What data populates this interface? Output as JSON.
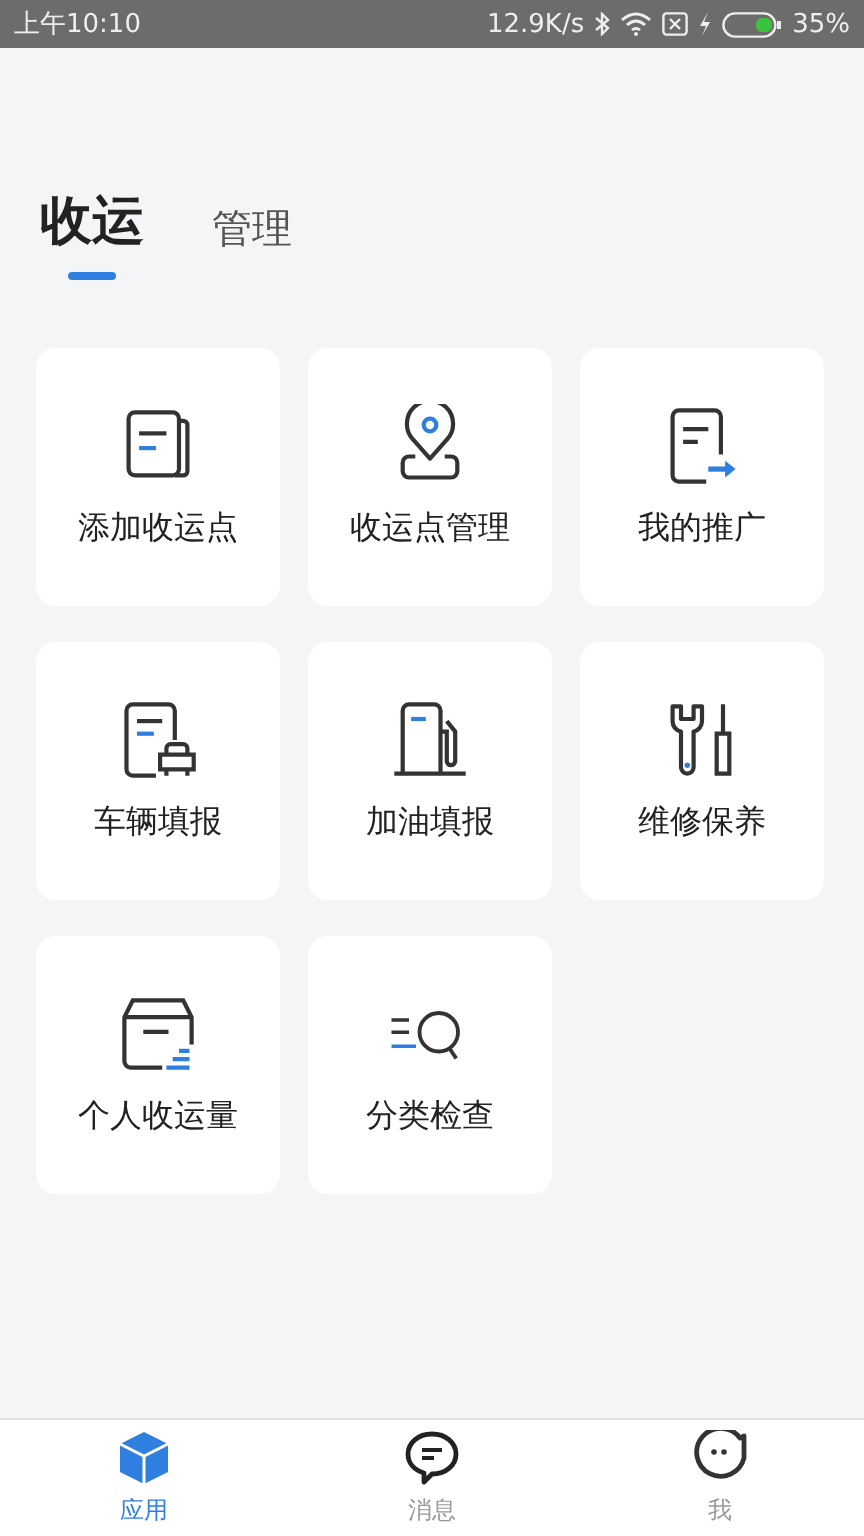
{
  "status_bar": {
    "time": "上午10:10",
    "speed": "12.9K/s",
    "battery": "35%"
  },
  "tabs": [
    {
      "label": "收运",
      "selected": true
    },
    {
      "label": "管理",
      "selected": false
    }
  ],
  "apps": [
    {
      "label": "添加收运点",
      "kind": "document"
    },
    {
      "label": "收运点管理",
      "kind": "location"
    },
    {
      "label": "我的推广",
      "kind": "share"
    },
    {
      "label": "车辆填报",
      "kind": "vehicle"
    },
    {
      "label": "加油填报",
      "kind": "fuel"
    },
    {
      "label": "维修保养",
      "kind": "repair"
    },
    {
      "label": "个人收运量",
      "kind": "box"
    },
    {
      "label": "分类检查",
      "kind": "inspect"
    }
  ],
  "bottom_nav": [
    {
      "label": "应用",
      "kind": "apps",
      "selected": true
    },
    {
      "label": "消息",
      "kind": "messages",
      "selected": false
    },
    {
      "label": "我",
      "kind": "profile",
      "selected": false
    }
  ]
}
